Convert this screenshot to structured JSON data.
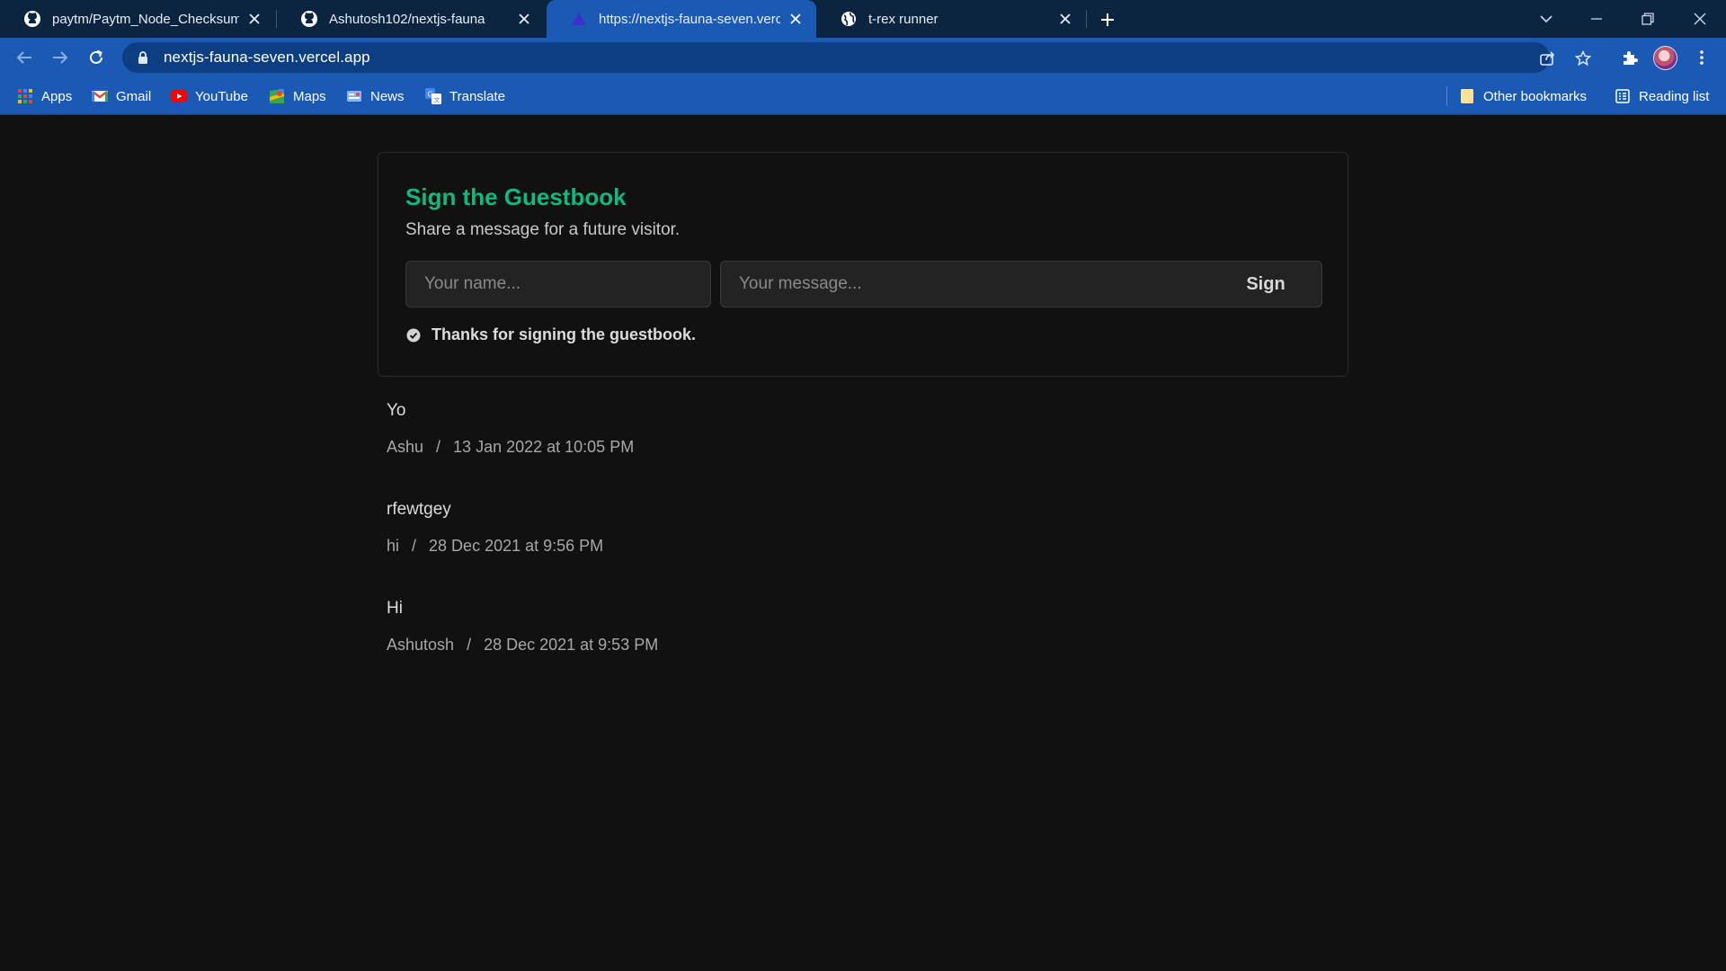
{
  "browser": {
    "tabs": [
      {
        "title": "paytm/Paytm_Node_Checksum",
        "icon": "github-icon"
      },
      {
        "title": "Ashutosh102/nextjs-fauna",
        "icon": "github-icon"
      },
      {
        "title": "https://nextjs-fauna-seven.vercel",
        "icon": "vercel-icon"
      },
      {
        "title": "t-rex runner",
        "icon": "globe-icon"
      }
    ],
    "url": "nextjs-fauna-seven.vercel.app",
    "bookmarks": [
      {
        "label": "Apps",
        "icon": "apps-grid-icon"
      },
      {
        "label": "Gmail",
        "icon": "gmail-icon"
      },
      {
        "label": "YouTube",
        "icon": "youtube-icon"
      },
      {
        "label": "Maps",
        "icon": "maps-icon"
      },
      {
        "label": "News",
        "icon": "news-icon"
      },
      {
        "label": "Translate",
        "icon": "translate-icon"
      }
    ],
    "other_bookmarks": "Other bookmarks",
    "reading_list": "Reading list"
  },
  "guestbook": {
    "title": "Sign the Guestbook",
    "subtitle": "Share a message for a future visitor.",
    "name_placeholder": "Your name...",
    "message_placeholder": "Your message...",
    "sign_label": "Sign",
    "success_message": "Thanks for signing the guestbook."
  },
  "entries": [
    {
      "message": "Yo",
      "author": "Ashu",
      "date": "13 Jan 2022 at 10:05 PM"
    },
    {
      "message": "rfewtgey",
      "author": "hi",
      "date": "28 Dec 2021 at 9:56 PM"
    },
    {
      "message": "Hi",
      "author": "Ashutosh",
      "date": "28 Dec 2021 at 9:53 PM"
    }
  ],
  "separator": "/",
  "colors": {
    "accent_green": "#10b981",
    "chrome_blue": "#1a5ab4",
    "tabstrip_navy": "#0b2440",
    "page_background": "#111111"
  }
}
